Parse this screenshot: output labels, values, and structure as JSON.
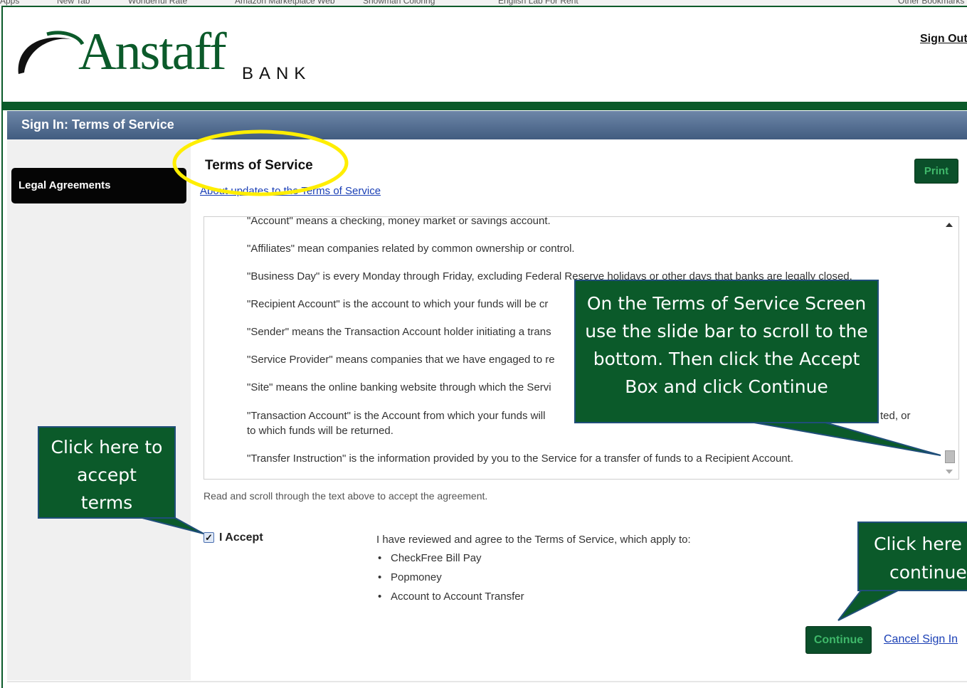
{
  "bookmarks_bar": {
    "items": [
      "Apps",
      "New Tab",
      "Wonderful Rate",
      "Amazon Marketplace Web",
      "Snowman Coloring",
      "English Lab For Rent",
      "Other Bookmarks"
    ]
  },
  "header": {
    "logo_word": "Anstaff",
    "logo_suffix": "BANK",
    "sign_out": "Sign Out"
  },
  "title_bar": {
    "title": "Sign In: Terms of Service"
  },
  "sidebar": {
    "items": [
      {
        "label": "Legal Agreements",
        "active": true
      }
    ]
  },
  "main": {
    "heading": "Terms of Service",
    "about_link": "About updates to the Terms of Service",
    "print_label": "Print",
    "definitions": [
      "\"Account\" means a checking, money market or savings account.",
      "\"Affiliates\" mean companies related by common ownership or control.",
      "\"Business Day\" is every Monday through Friday, excluding Federal Reserve holidays or other days that banks are legally closed.",
      "\"Recipient Account\" is the account to which your funds will be cr",
      "\"Sender\" means the Transaction Account holder initiating a trans",
      "\"Service Provider\" means companies that we have engaged to re",
      "\"Site\" means the online banking website through which the Servi",
      "\"Transaction Account\" is the Account from which your funds will",
      "ted, or",
      "to which funds will be returned.",
      "\"Transfer Instruction\" is the information provided by you to the Service for a transfer of funds to a Recipient Account."
    ],
    "scroll_instruction": "Read and scroll through the text above to accept the agreement.",
    "accept_label": "I Accept",
    "accept_checked": true,
    "reviewed_text": "I have reviewed and agree to the Terms of Service, which apply to:",
    "services": [
      "CheckFree Bill Pay",
      "Popmoney",
      "Account to Account Transfer"
    ],
    "continue_label": "Continue",
    "cancel_label": "Cancel Sign In"
  },
  "callouts": {
    "scroll": [
      "On the Terms of Service Screen",
      "use the slide bar to scroll to the",
      "bottom.  Then click the Accept",
      "Box and click Continue"
    ],
    "accept": [
      "Click here to",
      "accept",
      "terms"
    ],
    "continue": [
      "Click here t",
      "continue"
    ]
  },
  "colors": {
    "brand_green": "#0b5a2a",
    "button_green": "#0b4f2a",
    "button_text": "#3fb86a",
    "title_bar": "#4e6a8e",
    "link_blue": "#1a3fb5",
    "highlight_yellow": "#ffee00"
  }
}
